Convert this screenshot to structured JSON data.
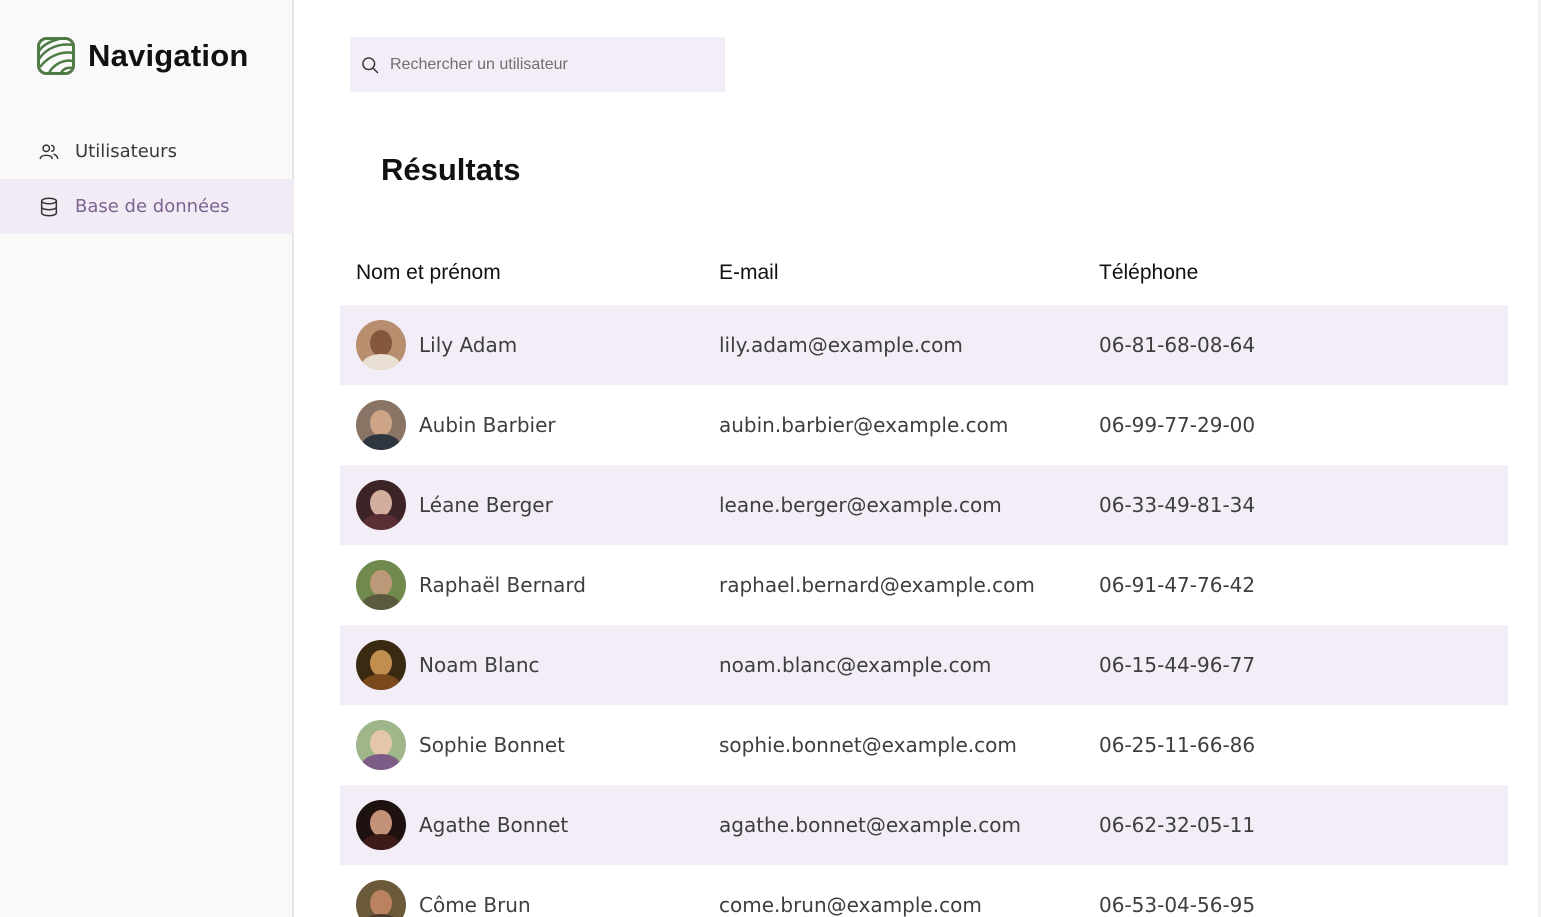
{
  "sidebar": {
    "logo_icon": "leaf-pattern-logo-icon",
    "title": "Navigation",
    "items": [
      {
        "label": "Utilisateurs",
        "icon": "users-icon",
        "active": false
      },
      {
        "label": "Base de données",
        "icon": "database-icon",
        "active": true
      }
    ]
  },
  "search": {
    "placeholder": "Rechercher un utilisateur",
    "value": "",
    "icon": "search-icon"
  },
  "results": {
    "title": "Résultats",
    "columns": [
      "Nom et prénom",
      "E-mail",
      "Téléphone"
    ],
    "rows": [
      {
        "name": "Lily Adam",
        "email": "lily.adam@example.com",
        "phone": "06-81-68-08-64"
      },
      {
        "name": "Aubin Barbier",
        "email": "aubin.barbier@example.com",
        "phone": "06-99-77-29-00"
      },
      {
        "name": "Léane Berger",
        "email": "leane.berger@example.com",
        "phone": "06-33-49-81-34"
      },
      {
        "name": "Raphaël Bernard",
        "email": "raphael.bernard@example.com",
        "phone": "06-91-47-76-42"
      },
      {
        "name": "Noam Blanc",
        "email": "noam.blanc@example.com",
        "phone": "06-15-44-96-77"
      },
      {
        "name": "Sophie Bonnet",
        "email": "sophie.bonnet@example.com",
        "phone": "06-25-11-66-86"
      },
      {
        "name": "Agathe Bonnet",
        "email": "agathe.bonnet@example.com",
        "phone": "06-62-32-05-11"
      },
      {
        "name": "Côme Brun",
        "email": "come.brun@example.com",
        "phone": "06-53-04-56-95"
      }
    ]
  },
  "colors": {
    "accent": "#7c6390",
    "row_highlight": "#f2edf6",
    "logo_green": "#4e7a45"
  }
}
